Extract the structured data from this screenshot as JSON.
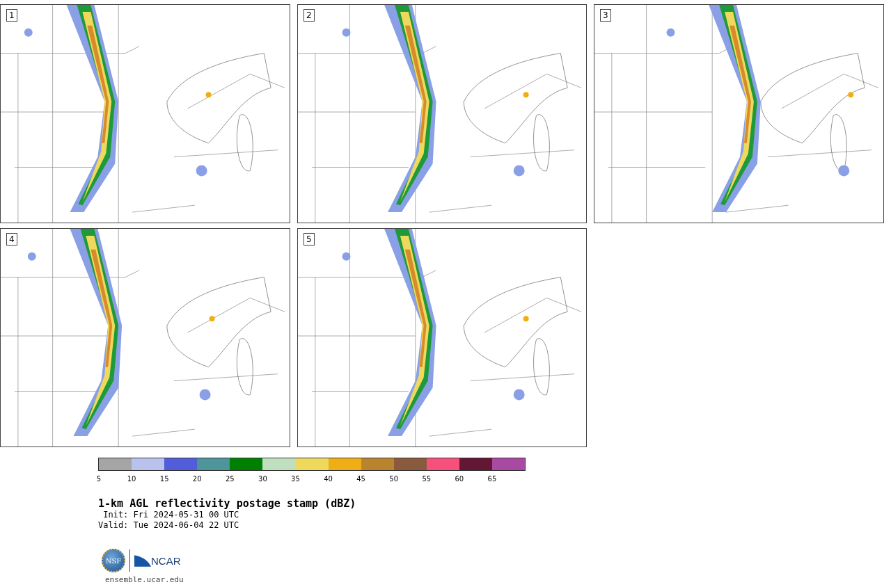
{
  "panels": [
    {
      "label": "1"
    },
    {
      "label": "2"
    },
    {
      "label": "3"
    },
    {
      "label": "4"
    },
    {
      "label": "5"
    }
  ],
  "colorbar": {
    "bins": [
      {
        "color": "#a5a5a5",
        "label": "5"
      },
      {
        "color": "#b8c2ed",
        "label": "10"
      },
      {
        "color": "#525ed9",
        "label": "15"
      },
      {
        "color": "#4d959a",
        "label": "20"
      },
      {
        "color": "#008000",
        "label": "25"
      },
      {
        "color": "#bfdfbf",
        "label": "30"
      },
      {
        "color": "#efd95c",
        "label": "35"
      },
      {
        "color": "#efae16",
        "label": "40"
      },
      {
        "color": "#ba842f",
        "label": "45"
      },
      {
        "color": "#8a5a3e",
        "label": "50"
      },
      {
        "color": "#f6507c",
        "label": "55"
      },
      {
        "color": "#631734",
        "label": "60"
      },
      {
        "color": "#a84aa2",
        "label": "65"
      }
    ]
  },
  "title": "1-km AGL reflectivity postage stamp (dBZ)",
  "init": " Init: Fri 2024-05-31 00 UTC",
  "valid": "Valid: Tue 2024-06-04 22 UTC",
  "logos": {
    "nsf": "NSF",
    "ncar": "NCAR"
  },
  "url": "ensemble.ucar.edu"
}
